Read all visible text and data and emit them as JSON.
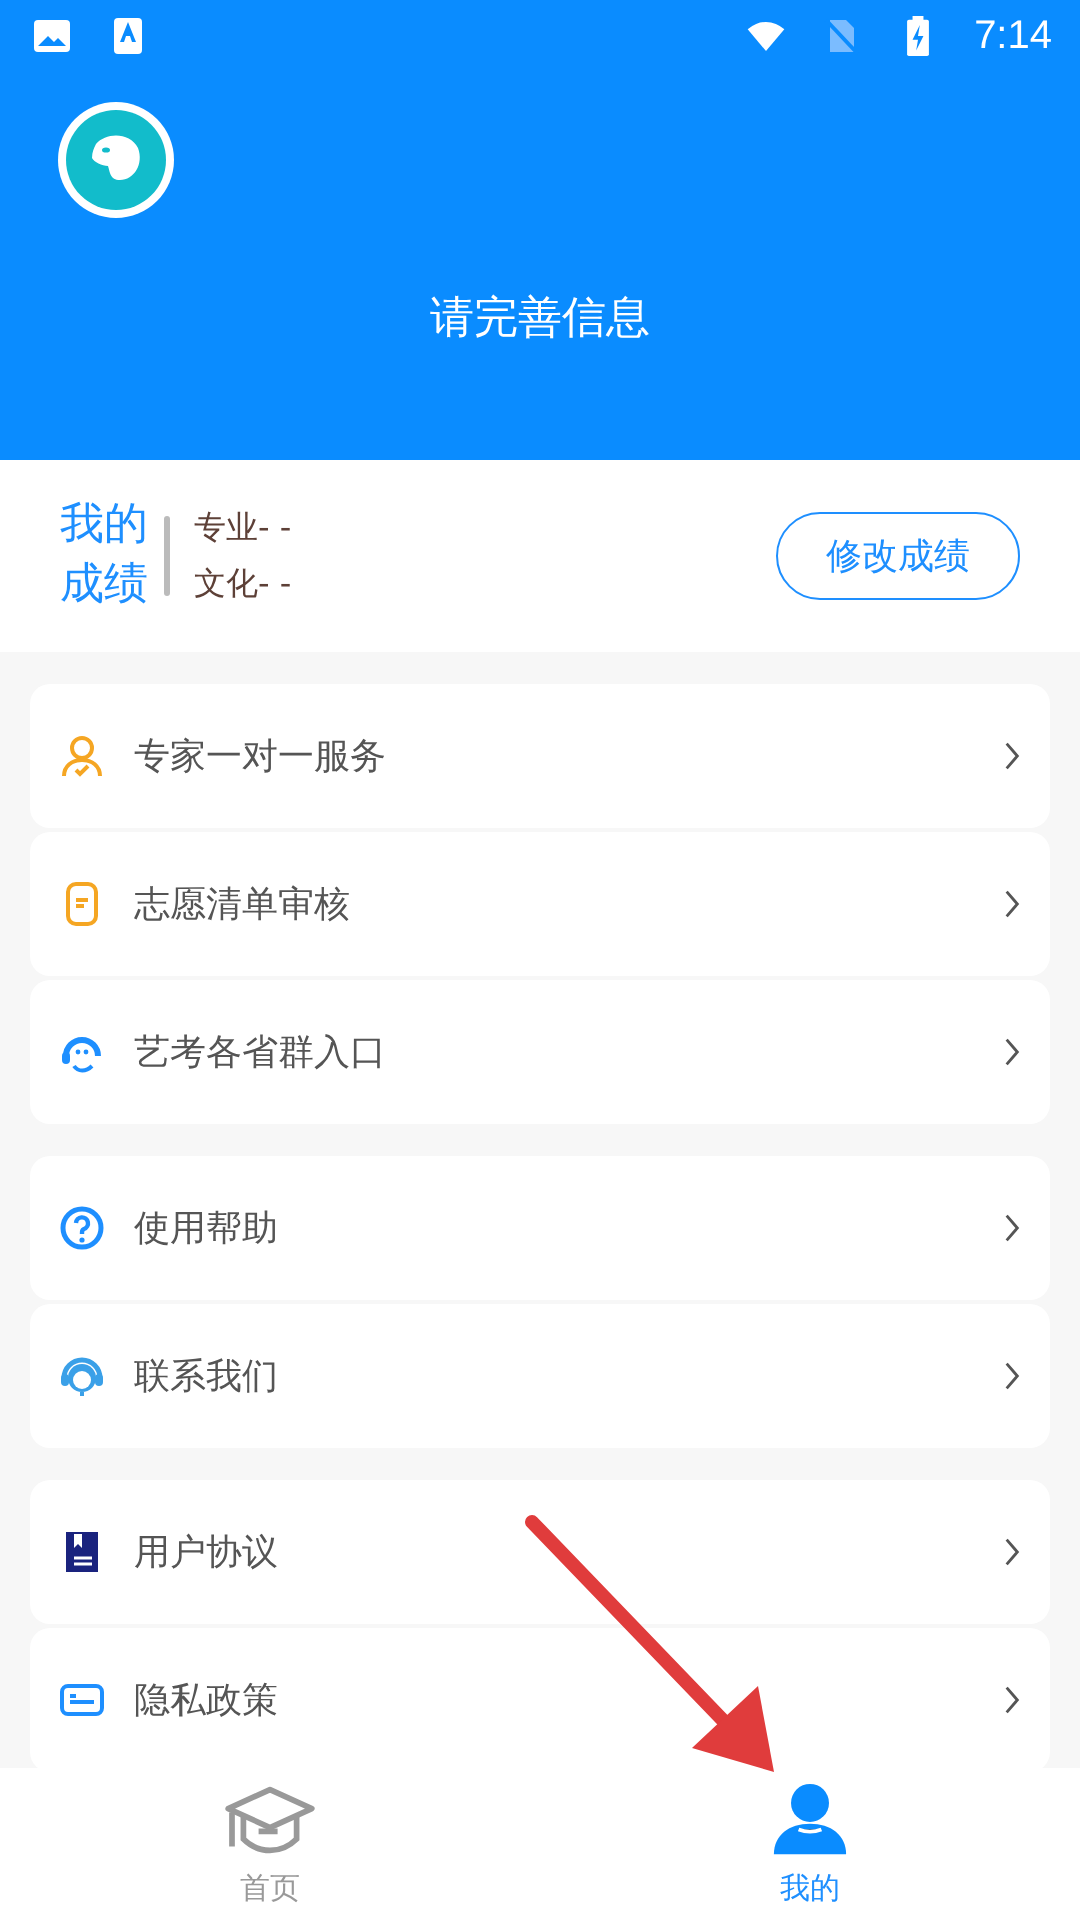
{
  "status_bar": {
    "time": "7:14"
  },
  "header": {
    "title": "请完善信息"
  },
  "scores": {
    "title_lines": [
      "我的",
      "成绩"
    ],
    "items": [
      "专业- -",
      "文化- -"
    ],
    "button": "修改成绩"
  },
  "menu_groups": [
    {
      "items": [
        {
          "kind": "expert",
          "label": "专家一对一服务"
        },
        {
          "kind": "checklist",
          "label": "志愿清单审核"
        },
        {
          "kind": "group",
          "label": "艺考各省群入口"
        }
      ]
    },
    {
      "items": [
        {
          "kind": "help",
          "label": "使用帮助"
        },
        {
          "kind": "contact",
          "label": "联系我们"
        }
      ]
    },
    {
      "items": [
        {
          "kind": "agreement",
          "label": "用户协议"
        },
        {
          "kind": "privacy",
          "label": "隐私政策"
        }
      ]
    }
  ],
  "tabs": [
    {
      "kind": "home",
      "label": "首页",
      "selected": false
    },
    {
      "kind": "profile",
      "label": "我的",
      "selected": true
    }
  ]
}
